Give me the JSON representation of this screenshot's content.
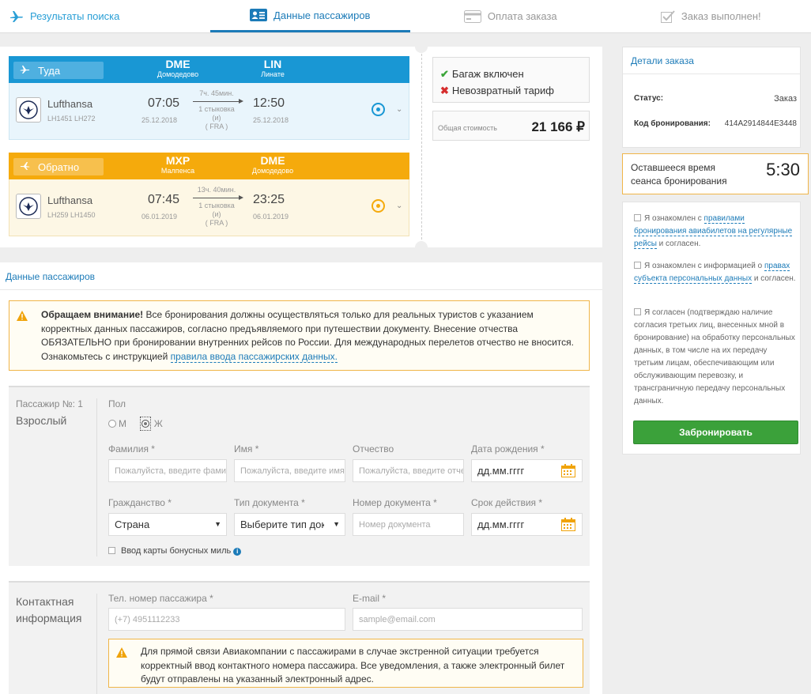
{
  "steps": [
    {
      "label": "Результаты поиска",
      "state": "done"
    },
    {
      "label": "Данные пассажиров",
      "state": "active"
    },
    {
      "label": "Оплата заказа",
      "state": "todo"
    },
    {
      "label": "Заказ выполнен!",
      "state": "todo"
    }
  ],
  "outbound": {
    "direction": "Туда",
    "from_code": "DME",
    "from_city": "Домодедово",
    "to_code": "LIN",
    "to_city": "Линате",
    "airline": "Lufthansa",
    "flights": "LH1451 LH272",
    "dep_time": "07:05",
    "dep_date": "25.12.2018",
    "arr_time": "12:50",
    "arr_date": "25.12.2018",
    "duration": "7ч. 45мин.",
    "stops": "1 стыковка",
    "via_and": "(и)",
    "via": "( FRA )"
  },
  "inbound": {
    "direction": "Обратно",
    "from_code": "MXP",
    "from_city": "Малпенса",
    "to_code": "DME",
    "to_city": "Домодедово",
    "airline": "Lufthansa",
    "flights": "LH259 LH1450",
    "dep_time": "07:45",
    "dep_date": "06.01.2019",
    "arr_time": "23:25",
    "arr_date": "06.01.2019",
    "duration": "13ч. 40мин.",
    "stops": "1 стыковка",
    "via_and": "(и)",
    "via": "( FRA )"
  },
  "fare": {
    "baggage": "Багаж включен",
    "refund": "Невозвратный тариф",
    "total_label": "Общая стоимость",
    "total_value": "21 166 ₽"
  },
  "order": {
    "title": "Детали заказа",
    "status_label": "Статус:",
    "status_value": "Заказ",
    "code_label": "Код бронирования:",
    "code_value": "414A2914844E3448"
  },
  "timer": {
    "label_line1": "Оставшееся время",
    "label_line2": "сеанса бронирования",
    "value": "5:30"
  },
  "consent": {
    "c1_pre": "Я ознакомлен с ",
    "c1_link": "правилами бронирования авиабилетов на регулярные рейсы",
    "c1_post": " и согласен.",
    "c2_pre": "Я ознакомлен с информацией о ",
    "c2_link": "правах субъекта персональных данных",
    "c2_post": " и согласен.",
    "c3": "Я согласен (подтверждаю наличие согласия третьих лиц, внесенных мной в бронирование) на обработку персональных данных, в том числе на их передачу третьим лицам, обеспечивающим или обслуживающим перевозку, и трансграничную передачу персональных данных.",
    "book_button": "Забронировать"
  },
  "pax_section": {
    "title": "Данные пассажиров",
    "warn_bold": "Обращаем внимание!",
    "warn_text": " Все бронирования должны осуществляться только для реальных туристов с указанием корректных данных пассажиров, согласно предъявляемого при путешествии документу. Внесение отчества ОБЯЗАТЕЛЬНО при бронировании внутренних рейсов по России. Для международных перелетов отчество не вносится. Ознакомьтесь с инструкцией ",
    "warn_link": "правила ввода пассажирских данных.",
    "pax_num": "Пассажир №: 1",
    "pax_type": "Взрослый",
    "gender_label": "Пол",
    "gender_m": "М",
    "gender_f": "Ж",
    "surname_label": "Фамилия *",
    "surname_ph": "Пожалуйста, введите фамилию",
    "name_label": "Имя *",
    "name_ph": "Пожалуйста, введите имя",
    "patronymic_label": "Отчество",
    "patronymic_ph": "Пожалуйста, введите отчество",
    "dob_label": "Дата рождения *",
    "dob_value": "дд.мм.гггг",
    "citizenship_label": "Гражданство *",
    "citizenship_value": "Страна",
    "doctype_label": "Тип документа *",
    "doctype_value": "Выберите тип документа",
    "docnum_label": "Номер документа *",
    "docnum_ph": "Номер документа",
    "expiry_label": "Срок действия *",
    "expiry_value": "дд.мм.гггг",
    "bonus_label": "Ввод карты бонусных миль"
  },
  "contact": {
    "title_line1": "Контактная",
    "title_line2": "информация",
    "phone_label": "Тел. номер пассажира *",
    "phone_ph": "(+7) 4951112233",
    "email_label": "E-mail *",
    "email_ph": "sample@email.com",
    "warn": "Для прямой связи Авиакомпании с пассажирами в случае экстренной ситуации требуется корректный ввод контактного номера пассажира. Все уведомления, а также электронный билет будут отправлены на указанный электронный адрес."
  }
}
